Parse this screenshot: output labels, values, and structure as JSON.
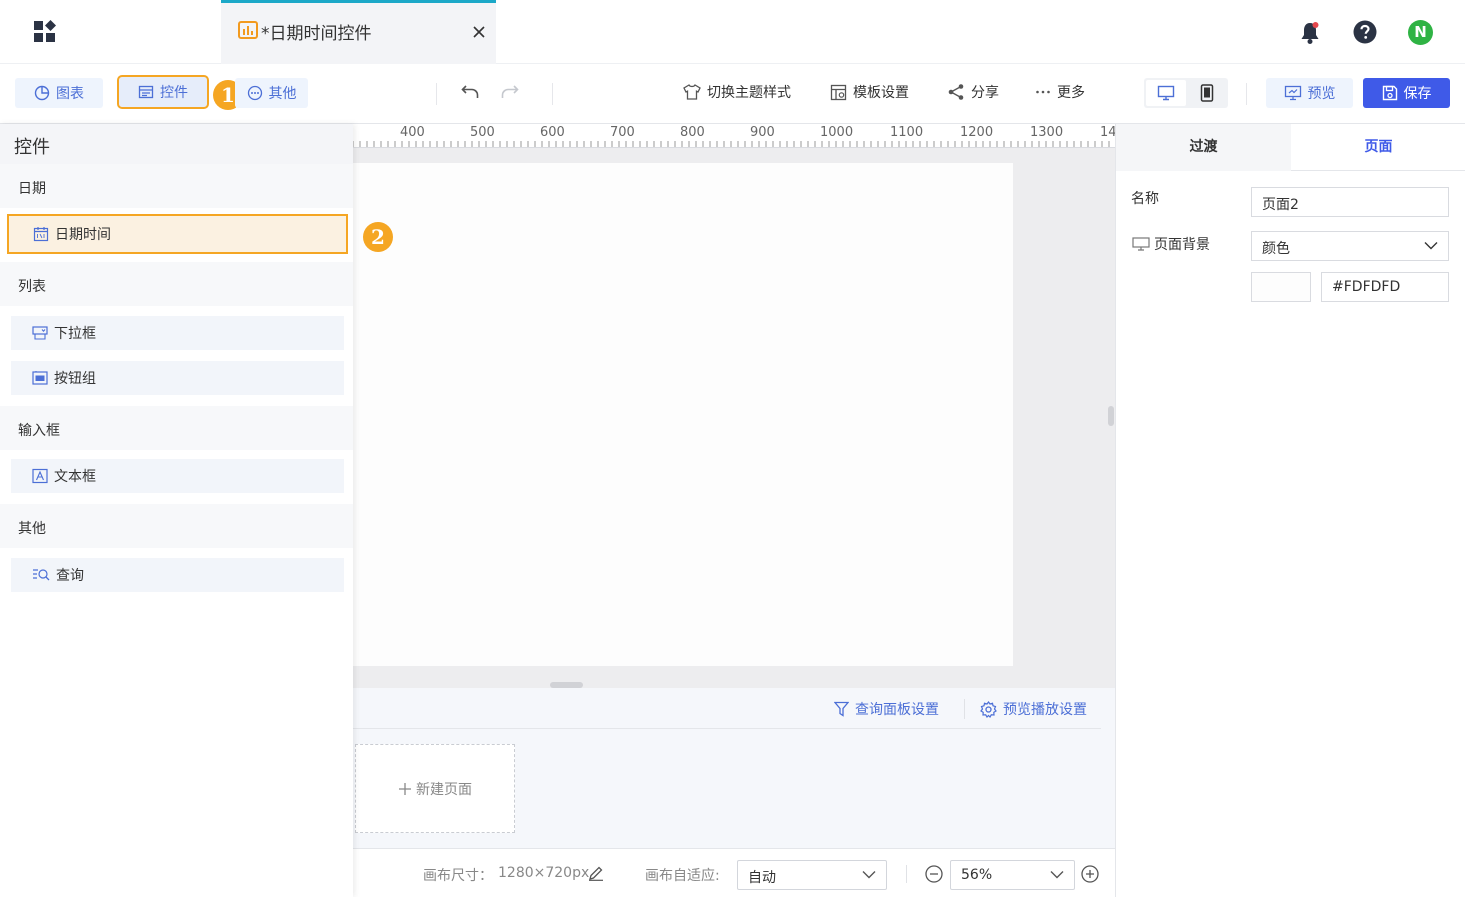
{
  "tab": {
    "title": "*日期时间控件"
  },
  "toolbar": {
    "chart_label": "图表",
    "controls_label": "控件",
    "other_label": "其他",
    "theme_label": "切换主题样式",
    "template_label": "模板设置",
    "share_label": "分享",
    "more_label": "更多",
    "preview_label": "预览",
    "save_label": "保存"
  },
  "header": {
    "avatar_letter": "N"
  },
  "callouts": {
    "step1": "1",
    "step2": "2"
  },
  "left_panel": {
    "title": "控件",
    "categories": [
      {
        "label": "日期",
        "items": [
          {
            "label": "日期时间",
            "icon": "calendar-icon"
          }
        ]
      },
      {
        "label": "列表",
        "items": [
          {
            "label": "下拉框",
            "icon": "dropdown-icon"
          },
          {
            "label": "按钮组",
            "icon": "button-group-icon"
          }
        ]
      },
      {
        "label": "输入框",
        "items": [
          {
            "label": "文本框",
            "icon": "textbox-icon"
          }
        ]
      },
      {
        "label": "其他",
        "items": [
          {
            "label": "查询",
            "icon": "query-icon"
          }
        ]
      }
    ]
  },
  "ruler": {
    "labels": [
      "400",
      "500",
      "600",
      "700",
      "800",
      "900",
      "1000",
      "1100",
      "1200",
      "1300",
      "14"
    ]
  },
  "pages_panel": {
    "query_settings": "查询面板设置",
    "playback_settings": "预览播放设置",
    "new_page": "新建页面"
  },
  "status": {
    "canvas_size_label": "画布尺寸：",
    "canvas_size_value": "1280×720px",
    "fit_label": "画布自适应:",
    "fit_value": "自动",
    "zoom_value": "56%"
  },
  "right_panel": {
    "tabs": [
      "过渡",
      "页面"
    ],
    "active_tab": "页面",
    "name_label": "名称",
    "name_value": "页面2",
    "bg_label": "页面背景",
    "bg_type": "颜色",
    "bg_color": "#FDFDFD"
  },
  "colors": {
    "accent": "#4c6fd6",
    "highlight": "#f5a623",
    "save_button": "#3f5ae8"
  }
}
